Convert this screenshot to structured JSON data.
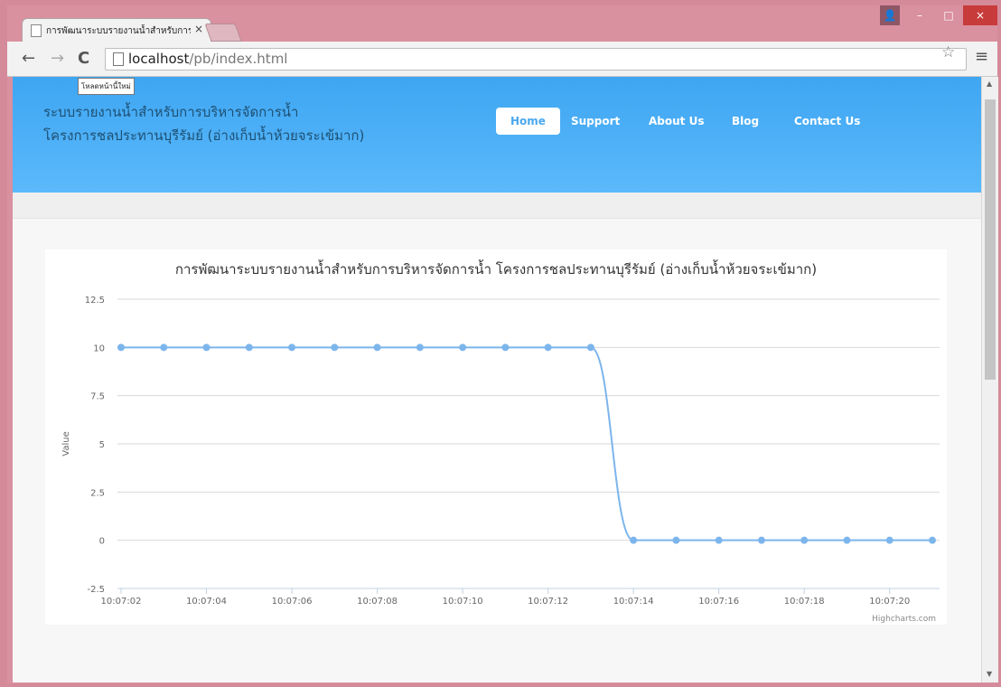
{
  "browser": {
    "tab_title": "การพัฒนาระบบรายงานน้ำสำหรับการบริหารจัดการน้ำ",
    "url_host": "localhost",
    "url_path": "/pb/index.html",
    "tooltip": "โหลดหน้านี้ใหม่",
    "icons": [
      "page-icon",
      "back-arrow-icon",
      "forward-arrow-icon",
      "reload-icon",
      "star-icon",
      "menu-icon",
      "profile-icon"
    ]
  },
  "site": {
    "title_line1": "ระบบรายงานน้ำสำหรับการบริหารจัดการน้ำ",
    "title_line2": "โครงการชลประทานบุรีรัมย์ (อ่างเก็บน้ำห้วยจระเข้มาก)",
    "nav": [
      "Home",
      "Support",
      "About Us",
      "Blog",
      "Contact Us"
    ],
    "active_nav": "Home",
    "header_color": "#4ab0f7"
  },
  "chart_data": {
    "type": "line",
    "title": "การพัฒนาระบบรายงานน้ำสำหรับการบริหารจัดการน้ำ โครงการชลประทานบุรีรัมย์ (อ่างเก็บน้ำห้วยจระเข้มาก)",
    "xlabel": "",
    "ylabel": "Value",
    "ylim": [
      -2.5,
      12.5
    ],
    "yticks": [
      "12.5",
      "10",
      "7.5",
      "5",
      "2.5",
      "0",
      "-2.5"
    ],
    "xticks": [
      "10:07:02",
      "10:07:04",
      "10:07:06",
      "10:07:08",
      "10:07:10",
      "10:07:12",
      "10:07:14",
      "10:07:16",
      "10:07:18",
      "10:07:20"
    ],
    "x_seconds_range": [
      2,
      21
    ],
    "grid": true,
    "credit": "Highcharts.com",
    "series": [
      {
        "color": "#7cb5ec",
        "x_seconds": [
          2,
          3,
          4,
          5,
          6,
          7,
          8,
          9,
          10,
          11,
          12,
          13,
          14,
          15,
          16,
          17,
          18,
          19,
          20,
          21
        ],
        "values": [
          10,
          10,
          10,
          10,
          10,
          10,
          10,
          10,
          10,
          10,
          10,
          10,
          0,
          0,
          0,
          0,
          0,
          0,
          0,
          0
        ]
      }
    ]
  }
}
